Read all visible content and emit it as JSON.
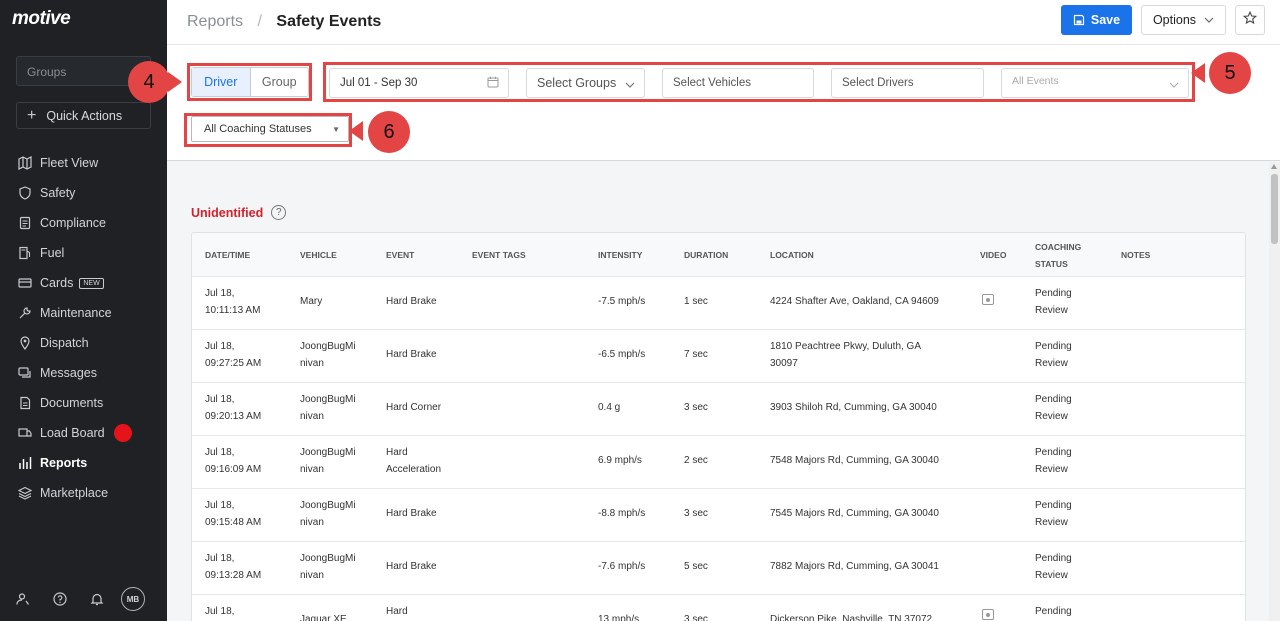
{
  "sidebar": {
    "logo": "motive",
    "groups_placeholder": "Groups",
    "quick_actions": "Quick Actions",
    "items": [
      {
        "label": "Fleet View",
        "icon": "map-icon"
      },
      {
        "label": "Safety",
        "icon": "shield-icon"
      },
      {
        "label": "Compliance",
        "icon": "clipboard-icon"
      },
      {
        "label": "Fuel",
        "icon": "fuel-icon"
      },
      {
        "label": "Cards",
        "icon": "card-icon",
        "badge": "NEW"
      },
      {
        "label": "Maintenance",
        "icon": "wrench-icon"
      },
      {
        "label": "Dispatch",
        "icon": "location-icon"
      },
      {
        "label": "Messages",
        "icon": "chat-icon"
      },
      {
        "label": "Documents",
        "icon": "document-icon"
      },
      {
        "label": "Load Board",
        "icon": "truck-icon"
      },
      {
        "label": "Reports",
        "icon": "chart-icon",
        "active": true
      },
      {
        "label": "Marketplace",
        "icon": "layers-icon"
      }
    ],
    "avatar_initials": "MB"
  },
  "header": {
    "breadcrumb_parent": "Reports",
    "breadcrumb_separator": "/",
    "title": "Safety Events",
    "save_label": "Save",
    "options_label": "Options"
  },
  "filters": {
    "toggle_driver": "Driver",
    "toggle_group": "Group",
    "date_range": "Jul 01 - Sep 30",
    "groups": "Select Groups",
    "vehicles": "Select Vehicles",
    "drivers": "Select Drivers",
    "events": "All Events",
    "coaching": "All Coaching Statuses"
  },
  "callouts": {
    "toggle": "4",
    "filters": "5",
    "coaching": "6"
  },
  "section": {
    "title": "Unidentified",
    "help": "?"
  },
  "table": {
    "headers": {
      "datetime": "DATE/TIME",
      "vehicle": "VEHICLE",
      "event": "EVENT",
      "tags": "EVENT TAGS",
      "intensity": "INTENSITY",
      "duration": "DURATION",
      "location": "LOCATION",
      "video": "VIDEO",
      "coaching1": "COACHING",
      "coaching2": "STATUS",
      "notes": "NOTES"
    },
    "rows": [
      {
        "date": "Jul 18,",
        "time": "10:11:13 AM",
        "vehicle1": "Mary",
        "vehicle2": "",
        "event1": "Hard Brake",
        "event2": "",
        "intensity": "-7.5 mph/s",
        "duration": "1 sec",
        "location1": "4224 Shafter Ave, Oakland, CA 94609",
        "location2": "",
        "status1": "Pending",
        "status2": "Review"
      },
      {
        "date": "Jul 18,",
        "time": "09:27:25 AM",
        "vehicle1": "JoongBugMi",
        "vehicle2": "nivan",
        "event1": "Hard Brake",
        "event2": "",
        "intensity": "-6.5 mph/s",
        "duration": "7 sec",
        "location1": "1810 Peachtree Pkwy, Duluth, GA",
        "location2": "30097",
        "status1": "Pending",
        "status2": "Review"
      },
      {
        "date": "Jul 18,",
        "time": "09:20:13 AM",
        "vehicle1": "JoongBugMi",
        "vehicle2": "nivan",
        "event1": "Hard Corner",
        "event2": "",
        "intensity": "0.4 g",
        "duration": "3 sec",
        "location1": "3903 Shiloh Rd, Cumming, GA 30040",
        "location2": "",
        "status1": "Pending",
        "status2": "Review"
      },
      {
        "date": "Jul 18,",
        "time": "09:16:09 AM",
        "vehicle1": "JoongBugMi",
        "vehicle2": "nivan",
        "event1": "Hard",
        "event2": "Acceleration",
        "intensity": "6.9 mph/s",
        "duration": "2 sec",
        "location1": "7548 Majors Rd, Cumming, GA 30040",
        "location2": "",
        "status1": "Pending",
        "status2": "Review"
      },
      {
        "date": "Jul 18,",
        "time": "09:15:48 AM",
        "vehicle1": "JoongBugMi",
        "vehicle2": "nivan",
        "event1": "Hard Brake",
        "event2": "",
        "intensity": "-8.8 mph/s",
        "duration": "3 sec",
        "location1": "7545 Majors Rd, Cumming, GA 30040",
        "location2": "",
        "status1": "Pending",
        "status2": "Review"
      },
      {
        "date": "Jul 18,",
        "time": "09:13:28 AM",
        "vehicle1": "JoongBugMi",
        "vehicle2": "nivan",
        "event1": "Hard Brake",
        "event2": "",
        "intensity": "-7.6 mph/s",
        "duration": "5 sec",
        "location1": "7882 Majors Rd, Cumming, GA 30041",
        "location2": "",
        "status1": "Pending",
        "status2": "Review"
      },
      {
        "date": "Jul 18,",
        "time": "",
        "vehicle1": "Jaguar XE",
        "vehicle2": "",
        "event1": "Hard",
        "event2": "",
        "intensity": "13 mph/s",
        "duration": "3 sec",
        "location1": "Dickerson Pike, Nashville, TN 37072",
        "location2": "",
        "status1": "Pending",
        "status2": ""
      }
    ]
  },
  "colors": {
    "accent": "#1a73e8",
    "annotation": "#e34545",
    "unidentified": "#d4202a",
    "sidebar_bg": "#1f2124"
  }
}
